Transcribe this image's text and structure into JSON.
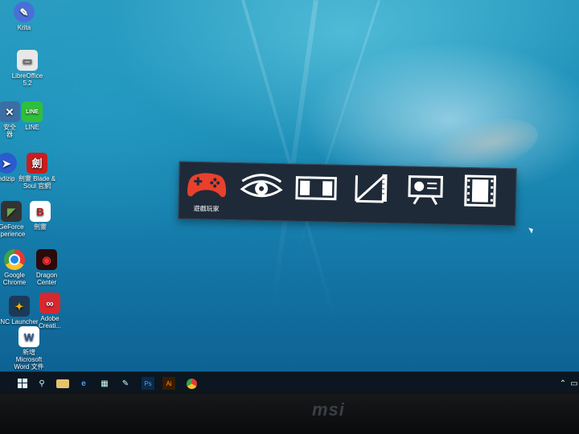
{
  "desktop_icons": [
    {
      "label": "Krita",
      "icon": "krita-icon",
      "color": "#4a6fd8"
    },
    {
      "label": "LibreOffice\n5.2",
      "icon": "document-icon",
      "color": "#e8e8e8"
    },
    {
      "label": "LINE",
      "icon": "line-icon",
      "color": "#2fbf3a"
    },
    {
      "label": "安全\n器",
      "icon": "security-icon",
      "color": "#3b6ea5"
    },
    {
      "label": "ndizip",
      "icon": "bandizip-icon",
      "color": "#2a5bd0"
    },
    {
      "label": "劍靈 Blade &\nSoul 官網",
      "icon": "blade-and-soul-icon",
      "color": "#c81e1e"
    },
    {
      "label": "GeForce\nxperience",
      "icon": "geforce-icon",
      "color": "#6aa84f"
    },
    {
      "label": "劍靈",
      "icon": "blade-soul-game-icon",
      "color": "#b31717"
    },
    {
      "label": "Google\nChrome",
      "icon": "chrome-icon",
      "color": "#e53935"
    },
    {
      "label": "Dragon\nCenter",
      "icon": "dragon-center-icon",
      "color": "#a31313"
    },
    {
      "label": "NC Launcher",
      "icon": "nc-launcher-icon",
      "color": "#f5b400"
    },
    {
      "label": "Adobe\nCreati...",
      "icon": "adobe-cc-icon",
      "color": "#d8282e"
    },
    {
      "label": "新增\nMicrosoft\nWord 文件",
      "icon": "word-document-icon",
      "color": "#2b579a"
    }
  ],
  "game_panel": {
    "modes": [
      {
        "name": "gaming-mode",
        "icon": "gamepad-icon",
        "caption": "遊戲玩家",
        "color": "#e8402d",
        "selected": true
      },
      {
        "name": "eye-care-mode",
        "icon": "eye-icon",
        "caption": "",
        "color": "#ffffff"
      },
      {
        "name": "display-mode",
        "icon": "split-screen-icon",
        "caption": "",
        "color": "#ffffff"
      },
      {
        "name": "design-mode",
        "icon": "ruler-triangle-icon",
        "caption": "",
        "color": "#ffffff"
      },
      {
        "name": "presentation-mode",
        "icon": "presentation-icon",
        "caption": "",
        "color": "#ffffff"
      },
      {
        "name": "movie-mode",
        "icon": "film-icon",
        "caption": "",
        "color": "#ffffff"
      }
    ]
  },
  "taskbar": {
    "items": [
      {
        "name": "start-button",
        "icon": "windows-logo-icon"
      },
      {
        "name": "search-button",
        "icon": "search-icon"
      },
      {
        "name": "file-explorer-button",
        "icon": "folder-icon"
      },
      {
        "name": "edge-button",
        "icon": "edge-icon"
      },
      {
        "name": "calculator-button",
        "icon": "calculator-icon"
      },
      {
        "name": "paint-button",
        "icon": "paint-icon"
      },
      {
        "name": "photoshop-button",
        "icon": "photoshop-icon",
        "label": "Ps"
      },
      {
        "name": "illustrator-button",
        "icon": "illustrator-icon",
        "label": "Ai"
      },
      {
        "name": "chrome-taskbar-button",
        "icon": "chrome-icon"
      }
    ],
    "tray": [
      {
        "name": "show-hidden-icons",
        "icon": "chevron-up-icon"
      },
      {
        "name": "message-icon",
        "icon": "message-icon"
      }
    ]
  },
  "bezel": {
    "brand": "msi"
  }
}
